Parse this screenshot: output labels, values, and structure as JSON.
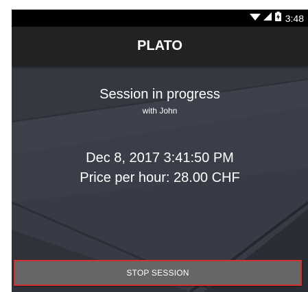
{
  "status_bar": {
    "time": "3:48",
    "icons": [
      "wifi-icon",
      "signal-icon",
      "battery-charging-icon"
    ]
  },
  "app_bar": {
    "title": "PLATO"
  },
  "session": {
    "title": "Session in progress",
    "subtitle": "with John",
    "datetime": "Dec 8, 2017 3:41:50 PM",
    "price": "Price per hour: 28.00 CHF"
  },
  "actions": {
    "stop_label": "STOP SESSION"
  },
  "colors": {
    "background": "#3a3d47",
    "app_bar": "#222222",
    "status_bar": "#000000",
    "button": "#666666",
    "button_highlight": "#d32f2f",
    "text": "#ffffff"
  }
}
